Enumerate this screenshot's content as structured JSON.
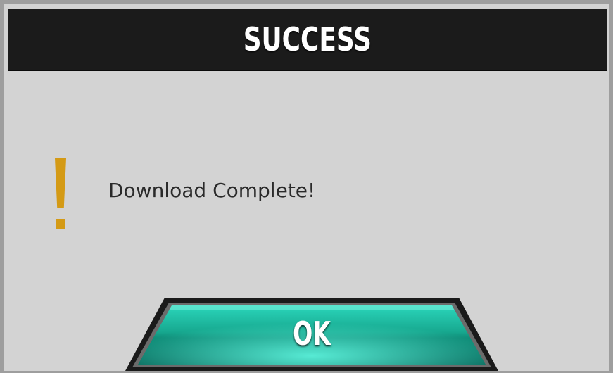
{
  "dialog": {
    "title": "SUCCESS",
    "message": "Download Complete!",
    "icon": "exclamation-icon",
    "ok_label": "OK"
  },
  "colors": {
    "titlebar": "#1b1b1b",
    "panel": "#d3d3d3",
    "icon": "#d49a15",
    "button": "#1fc2a8"
  }
}
